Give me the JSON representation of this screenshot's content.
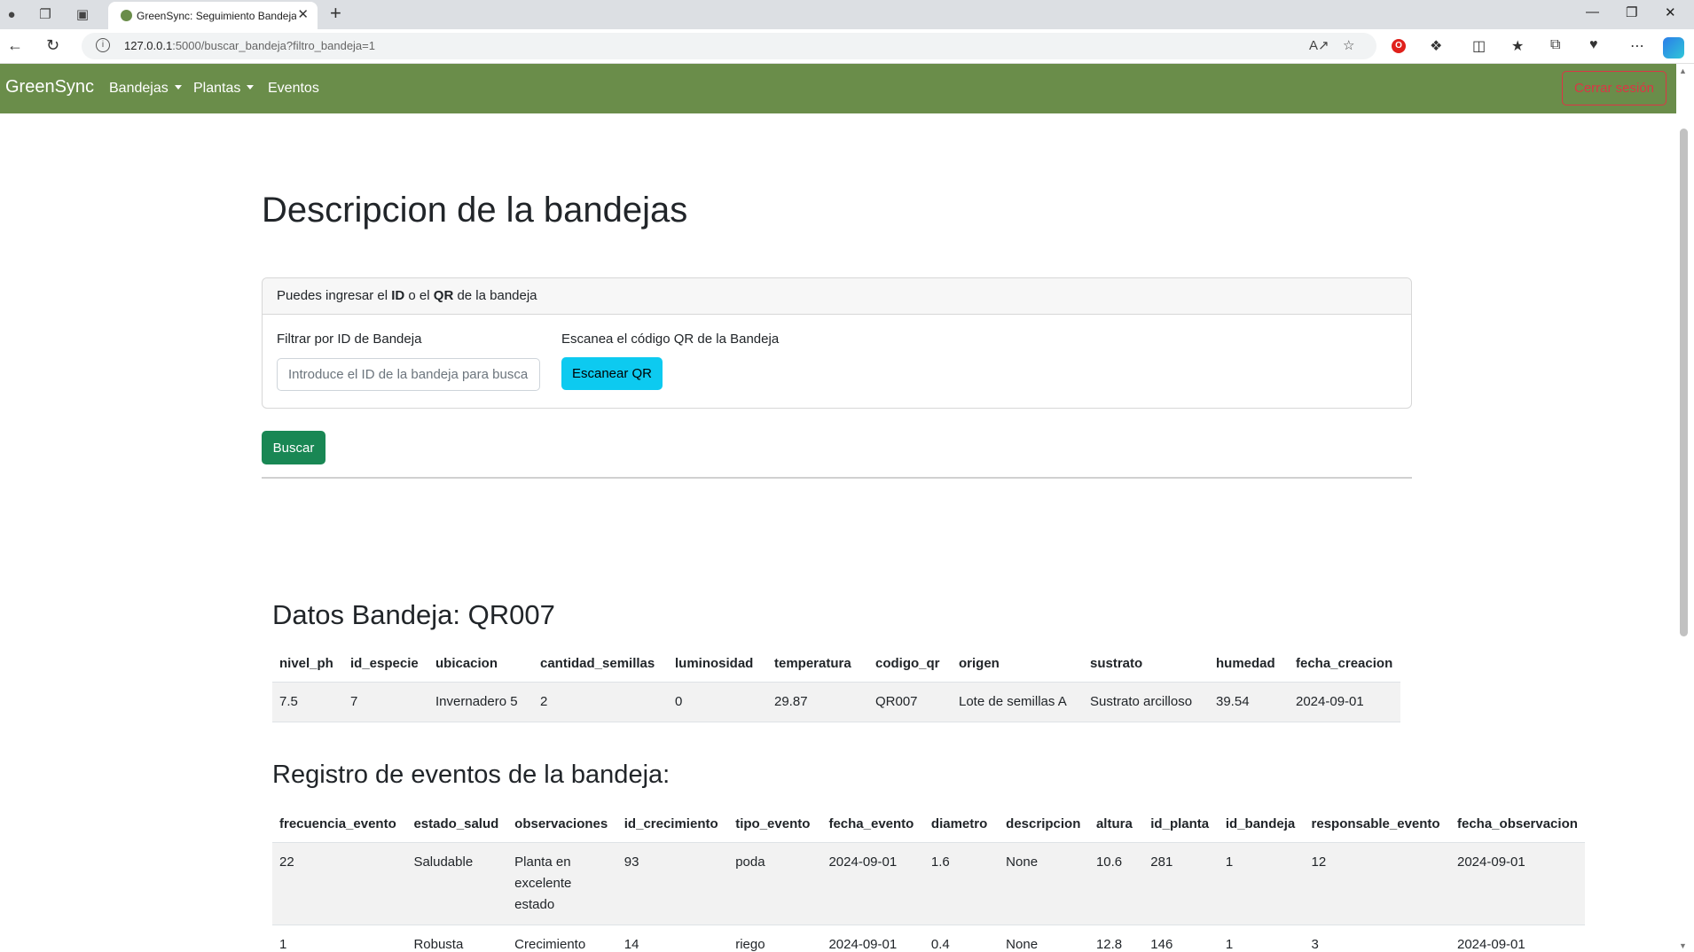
{
  "browser": {
    "tab_title": "GreenSync: Seguimiento Bandejas",
    "url_host": "127.0.0.1",
    "url_rest": ":5000/buscar_bandeja?filtro_bandeja=1"
  },
  "navbar": {
    "brand": "GreenSync",
    "links": [
      "Bandejas",
      "Plantas",
      "Eventos"
    ],
    "logout": "Cerrar sesión"
  },
  "page": {
    "title": "Descripcion de la bandejas"
  },
  "search_card": {
    "header_prefix": "Puedes ingresar el ",
    "header_id": "ID",
    "header_mid": " o el ",
    "header_qr": "QR",
    "header_suffix": " de la bandeja",
    "filter_label": "Filtrar por ID de Bandeja",
    "filter_placeholder": "Introduce el ID de la bandeja para buscar",
    "filter_value": "",
    "qr_label": "Escanea el código QR de la Bandeja",
    "qr_button": "Escanear QR",
    "search_button": "Buscar"
  },
  "bandeja": {
    "heading": "Datos Bandeja: QR007",
    "columns": [
      "nivel_ph",
      "id_especie",
      "ubicacion",
      "cantidad_semillas",
      "luminosidad",
      "temperatura",
      "codigo_qr",
      "origen",
      "sustrato",
      "humedad",
      "fecha_creacion"
    ],
    "rows": [
      [
        "7.5",
        "7",
        "Invernadero 5",
        "2",
        "0",
        "29.87",
        "QR007",
        "Lote de semillas A",
        "Sustrato arcilloso",
        "39.54",
        "2024-09-01"
      ]
    ]
  },
  "eventos": {
    "heading": "Registro de eventos de la bandeja:",
    "columns": [
      "frecuencia_evento",
      "estado_salud",
      "observaciones",
      "id_crecimiento",
      "tipo_evento",
      "fecha_evento",
      "diametro",
      "descripcion",
      "altura",
      "id_planta",
      "id_bandeja",
      "responsable_evento",
      "fecha_observacion"
    ],
    "rows": [
      [
        "22",
        "Saludable",
        "Planta en excelente estado",
        "93",
        "poda",
        "2024-09-01",
        "1.6",
        "None",
        "10.6",
        "281",
        "1",
        "12",
        "2024-09-01"
      ],
      [
        "1",
        "Robusta",
        "Crecimiento",
        "14",
        "riego",
        "2024-09-01",
        "0.4",
        "None",
        "12.8",
        "146",
        "1",
        "3",
        "2024-09-01"
      ]
    ]
  }
}
